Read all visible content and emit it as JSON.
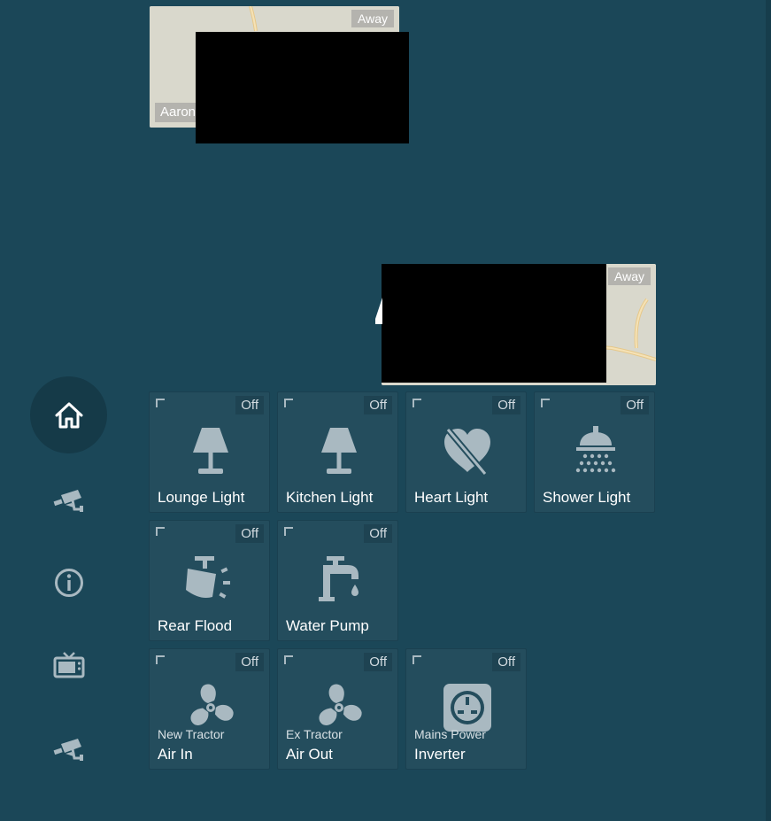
{
  "colors": {
    "background": "#1b4758",
    "tile": "#244d5d",
    "icon": "#a9b9c1",
    "map": "#d9d8cc",
    "road": "#e6c88a"
  },
  "sidebar": {
    "items": [
      {
        "name": "home-icon",
        "active": true
      },
      {
        "name": "cctv-camera-icon"
      },
      {
        "name": "info-icon"
      },
      {
        "name": "television-icon"
      },
      {
        "name": "cctv-camera-icon"
      }
    ]
  },
  "maps": [
    {
      "badge": "Away",
      "name": "Aaron"
    },
    {
      "badge": "Away"
    }
  ],
  "tiles": [
    {
      "label": "Lounge Light",
      "state": "Off",
      "icon": "lamp-icon"
    },
    {
      "label": "Kitchen Light",
      "state": "Off",
      "icon": "lamp-icon"
    },
    {
      "label": "Heart Light",
      "state": "Off",
      "icon": "heart-off-icon"
    },
    {
      "label": "Shower Light",
      "state": "Off",
      "icon": "shower-head-icon"
    },
    {
      "label": "Rear Flood",
      "state": "Off",
      "icon": "spotlight-beam-icon"
    },
    {
      "label": "Water Pump",
      "state": "Off",
      "icon": "water-pump-icon"
    },
    {
      "label": "Air In",
      "sublabel": "New Tractor",
      "state": "Off",
      "icon": "fan-icon"
    },
    {
      "label": "Air Out",
      "sublabel": "Ex Tractor",
      "state": "Off",
      "icon": "fan-icon"
    },
    {
      "label": "Inverter",
      "sublabel": "Mains Power",
      "state": "Off",
      "icon": "power-socket-icon"
    }
  ]
}
